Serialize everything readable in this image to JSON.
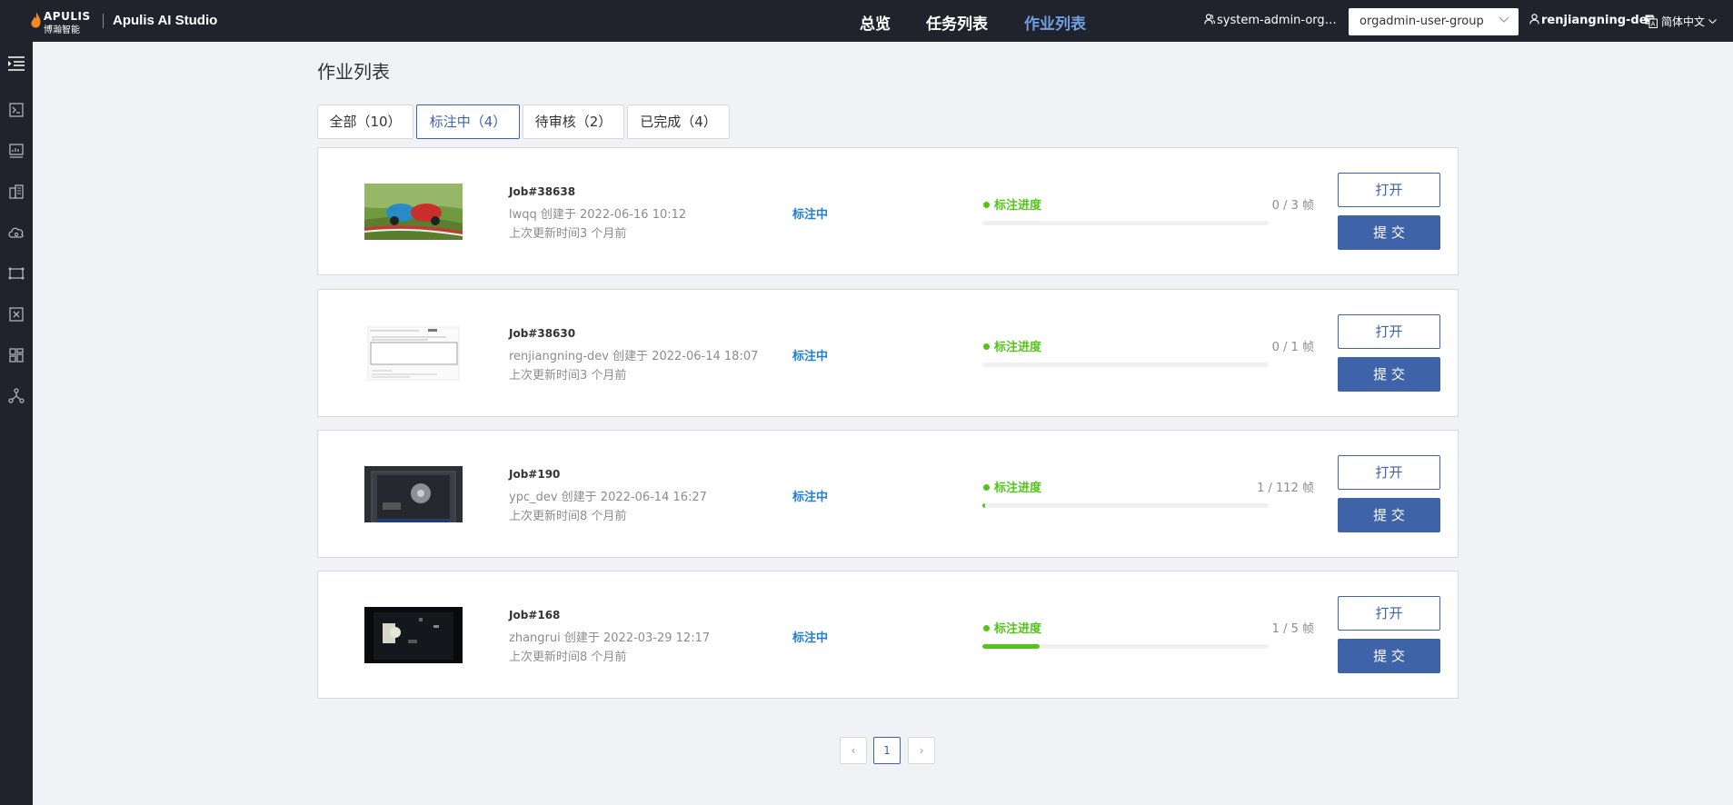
{
  "header": {
    "brand": "APULIS",
    "brand_cn": "博瀚智能",
    "app_title": "Apulis AI Studio",
    "nav": [
      {
        "label": "总览"
      },
      {
        "label": "任务列表"
      },
      {
        "label": "作业列表"
      }
    ],
    "org_user": "system-admin-organ...",
    "group_select": "orgadmin-user-group",
    "current_user": "renjiangning-dev",
    "language": "简体中文"
  },
  "sidebar": {
    "icons": [
      "menu-toggle-icon",
      "terminal-icon",
      "monitor-icon",
      "building-icon",
      "cloud-icon",
      "dataset-icon",
      "model-icon",
      "dashboard-icon",
      "network-icon"
    ]
  },
  "page": {
    "title": "作业列表"
  },
  "tabs": [
    {
      "label": "全部（10）"
    },
    {
      "label": "标注中（4）"
    },
    {
      "label": "待审核（2）"
    },
    {
      "label": "已完成（4）"
    }
  ],
  "progress_label": "标注进度",
  "open_label": "打开",
  "submit_label": "提 交",
  "jobs": [
    {
      "title": "Job#38638",
      "meta": "lwqq 创建于 2022-06-16 10:12",
      "updated": "上次更新时间3 个月前",
      "status": "标注中",
      "count": "0 / 3 帧",
      "progress": 0.0
    },
    {
      "title": "Job#38630",
      "meta": "renjiangning-dev 创建于 2022-06-14 18:07",
      "updated": "上次更新时间3 个月前",
      "status": "标注中",
      "count": "0 / 1 帧",
      "progress": 0.0
    },
    {
      "title": "Job#190",
      "meta": "ypc_dev 创建于 2022-06-14 16:27",
      "updated": "上次更新时间8 个月前",
      "status": "标注中",
      "count": "1 / 112 帧",
      "progress": 0.009
    },
    {
      "title": "Job#168",
      "meta": "zhangrui 创建于 2022-03-29 12:17",
      "updated": "上次更新时间8 个月前",
      "status": "标注中",
      "count": "1 / 5 帧",
      "progress": 0.2
    }
  ],
  "pagination": {
    "current": "1",
    "prev": "‹",
    "next": "›"
  },
  "colors": {
    "topbar": "#20232b",
    "accent": "#3e63a9",
    "status_blue": "#1f7ed8",
    "progress_green": "#52c41a"
  }
}
